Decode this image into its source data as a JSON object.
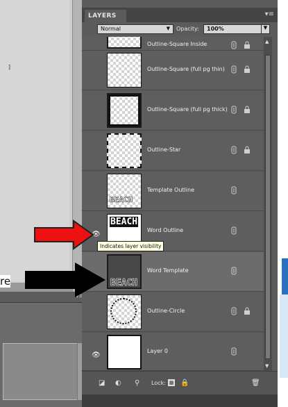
{
  "panel": {
    "tab_title": "LAYERS",
    "menu_glyph": "▾≡",
    "blend_mode": "Normal",
    "opacity_label": "Opacity:",
    "opacity_value": "100%"
  },
  "layers": [
    {
      "name": "Outline-Square Inside",
      "visible": false,
      "selected": false,
      "thumbnail": "square-inside",
      "has_lock": true
    },
    {
      "name": "Outline-Square (full pg thin)",
      "visible": false,
      "selected": false,
      "thumbnail": "square-thin",
      "has_lock": true
    },
    {
      "name": "Outline-Square (full pg thick)",
      "visible": false,
      "selected": false,
      "thumbnail": "square-thick",
      "has_lock": true
    },
    {
      "name": "Outline-Star",
      "visible": false,
      "selected": false,
      "thumbnail": "star-outline",
      "has_lock": true
    },
    {
      "name": "Template Outline",
      "visible": false,
      "selected": false,
      "thumbnail": "template-outline",
      "has_lock": false
    },
    {
      "name": "Word Outline",
      "visible": true,
      "selected": false,
      "thumbnail": "word-outline",
      "has_lock": false
    },
    {
      "name": "Word Template",
      "visible": false,
      "selected": true,
      "thumbnail": "word-template",
      "has_lock": false
    },
    {
      "name": "Outline-Circle",
      "visible": false,
      "selected": false,
      "thumbnail": "circle-outline",
      "has_lock": true
    },
    {
      "name": "Layer 0",
      "visible": true,
      "selected": false,
      "thumbnail": "white-fill",
      "has_lock": false
    }
  ],
  "thumb_text": {
    "word_template": "BEACH",
    "word_outline": "BEACH"
  },
  "tooltip": "Indicates layer visibility",
  "footer": {
    "lock_label": "Lock:"
  },
  "caption_fragment": "re",
  "icons": {
    "eye": "eye-icon",
    "mask": "mask-icon",
    "lock": "lock-icon",
    "new_layer": "new-layer-icon",
    "adjustment": "adjustment-layer-icon",
    "trash": "trash-icon",
    "lock_transparent": "lock-transparent-icon",
    "lock_all": "lock-all-icon"
  },
  "colors": {
    "panel_bg": "#5b5b5b",
    "row_bg": "#5e5e5e",
    "selected_row_bg": "#6c6c6c",
    "tooltip_bg": "#ffffe1",
    "red_arrow": "#ee1111",
    "black_arrow": "#000000"
  }
}
